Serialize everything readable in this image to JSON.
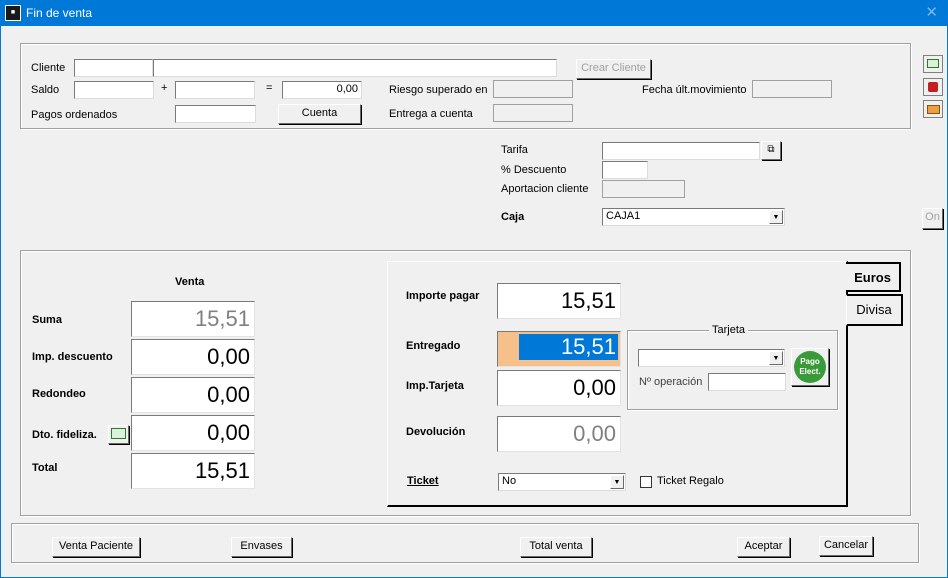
{
  "window": {
    "title": "Fin de venta",
    "close_glyph": "✕",
    "app_icon": "app-icon"
  },
  "cliente": {
    "label": "Cliente",
    "code_value": "",
    "name_value": "",
    "crear_label": "Crear Cliente"
  },
  "saldo": {
    "label": "Saldo",
    "value1": "",
    "plus": "+",
    "value2": "",
    "equals": "=",
    "total": "0,00",
    "riesgo_label": "Riesgo superado en",
    "riesgo_value": "",
    "fecha_label": "Fecha últ.movimiento",
    "fecha_value": ""
  },
  "pagos": {
    "label": "Pagos ordenados",
    "value": "",
    "cuenta_label": "Cuenta",
    "entrega_label": "Entrega a cuenta",
    "entrega_value": ""
  },
  "tarifa": {
    "tarifa_label": "Tarifa",
    "tarifa_value": "",
    "descuento_label": "% Descuento",
    "descuento_value": "",
    "aportacion_label": "Aportacion cliente",
    "aportacion_value": "",
    "caja_label": "Caja",
    "caja_value": "CAJA1"
  },
  "venta": {
    "header": "Venta",
    "suma_label": "Suma",
    "suma_value": "15,51",
    "imp_desc_label": "Imp. descuento",
    "imp_desc_value": "0,00",
    "redondeo_label": "Redondeo",
    "redondeo_value": "0,00",
    "dto_label": "Dto. fideliza.",
    "dto_value": "0,00",
    "total_label": "Total",
    "total_value": "15,51"
  },
  "pago": {
    "importe_label": "Importe pagar",
    "importe_value": "15,51",
    "entregado_label": "Entregado",
    "entregado_value": "15,51",
    "imp_tarjeta_label": "Imp.Tarjeta",
    "imp_tarjeta_value": "0,00",
    "devolucion_label": "Devolución",
    "devolucion_value": "0,00",
    "ticket_label": "Ticket",
    "ticket_value": "No",
    "ticket_regalo_label": "Ticket Regalo",
    "tarjeta_group": "Tarjeta",
    "tarjeta_value": "",
    "operacion_label": "Nº operación",
    "operacion_value": "",
    "pago_elect_line1": "Pago",
    "pago_elect_line2": "Elect."
  },
  "tabs": {
    "euros": "Euros",
    "divisa": "Divisa"
  },
  "side": {
    "on_label": "On"
  },
  "footer": {
    "venta_paciente": "Venta Paciente",
    "envases": "Envases",
    "total_venta": "Total venta",
    "aceptar": "Aceptar",
    "cancelar": "Cancelar"
  },
  "colors": {
    "titlebar": "#0078d7",
    "selection": "#0078d7",
    "entregado_accent": "#f5c08a"
  }
}
